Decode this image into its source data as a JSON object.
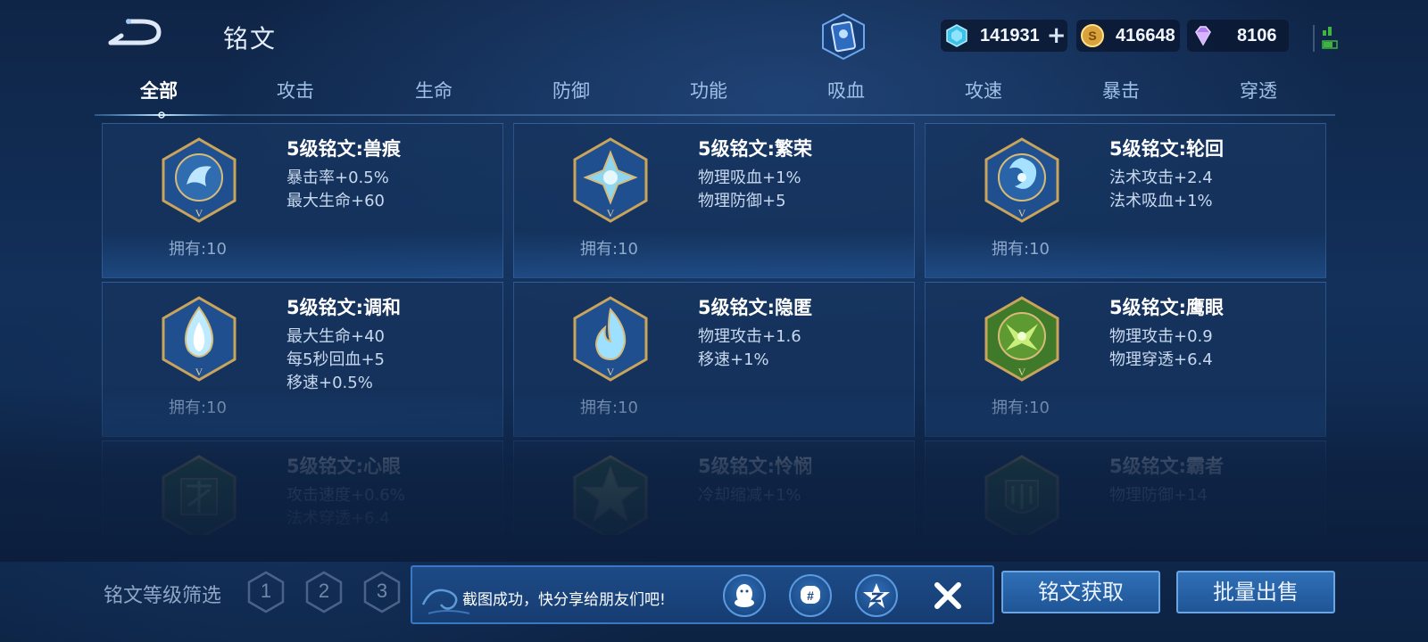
{
  "header": {
    "title": "铭文",
    "back_icon": "back-arrow-icon",
    "event_icon": "card-event-icon"
  },
  "currencies": {
    "gems": {
      "icon": "diamond-gem-icon",
      "value": "141931",
      "plus": "+"
    },
    "gold": {
      "icon": "gold-coin-icon",
      "value": "416648"
    },
    "crystal": {
      "icon": "purple-crystal-icon",
      "value": "8106"
    }
  },
  "tabs": [
    {
      "label": "全部",
      "active": true
    },
    {
      "label": "攻击"
    },
    {
      "label": "生命"
    },
    {
      "label": "防御"
    },
    {
      "label": "功能"
    },
    {
      "label": "吸血"
    },
    {
      "label": "攻速"
    },
    {
      "label": "暴击"
    },
    {
      "label": "穿透"
    }
  ],
  "cards": [
    {
      "title": "5级铭文:兽痕",
      "stats": [
        "暴击率+0.5%",
        "最大生命+60"
      ],
      "owned": "拥有:10",
      "color": "blue"
    },
    {
      "title": "5级铭文:繁荣",
      "stats": [
        "物理吸血+1%",
        "物理防御+5"
      ],
      "owned": "拥有:10",
      "color": "blue"
    },
    {
      "title": "5级铭文:轮回",
      "stats": [
        "法术攻击+2.4",
        "法术吸血+1%"
      ],
      "owned": "拥有:10",
      "color": "blue"
    },
    {
      "title": "5级铭文:调和",
      "stats": [
        "最大生命+40",
        "每5秒回血+5",
        "移速+0.5%"
      ],
      "owned": "拥有:10",
      "color": "blue"
    },
    {
      "title": "5级铭文:隐匿",
      "stats": [
        "物理攻击+1.6",
        "移速+1%"
      ],
      "owned": "拥有:10",
      "color": "blue"
    },
    {
      "title": "5级铭文:鹰眼",
      "stats": [
        "物理攻击+0.9",
        "物理穿透+6.4"
      ],
      "owned": "拥有:10",
      "color": "green"
    },
    {
      "title": "5级铭文:心眼",
      "stats": [
        "攻击速度+0.6%",
        "法术穿透+6.4"
      ],
      "owned": "",
      "color": "green"
    },
    {
      "title": "5级铭文:怜悯",
      "stats": [
        "冷却缩减+1%"
      ],
      "owned": "",
      "color": "green"
    },
    {
      "title": "5级铭文:霸者",
      "stats": [
        "物理防御+14"
      ],
      "owned": "",
      "color": "green"
    }
  ],
  "footer": {
    "filter_label": "铭文等级筛选",
    "levels": [
      "1",
      "2",
      "3"
    ],
    "toast_text": "截图成功，快分享给朋友们吧!",
    "share_icons": [
      "qq-icon",
      "wechat-moments-icon",
      "qzone-icon"
    ],
    "close_icon": "close-icon",
    "get_button": "铭文获取",
    "sell_button": "批量出售"
  },
  "colors": {
    "accent": "#3a78c4",
    "background": "#12305a",
    "rune_blue": "#1f4f8f",
    "rune_green": "#3f7a2a",
    "gold_frame": "#c9a45a"
  }
}
